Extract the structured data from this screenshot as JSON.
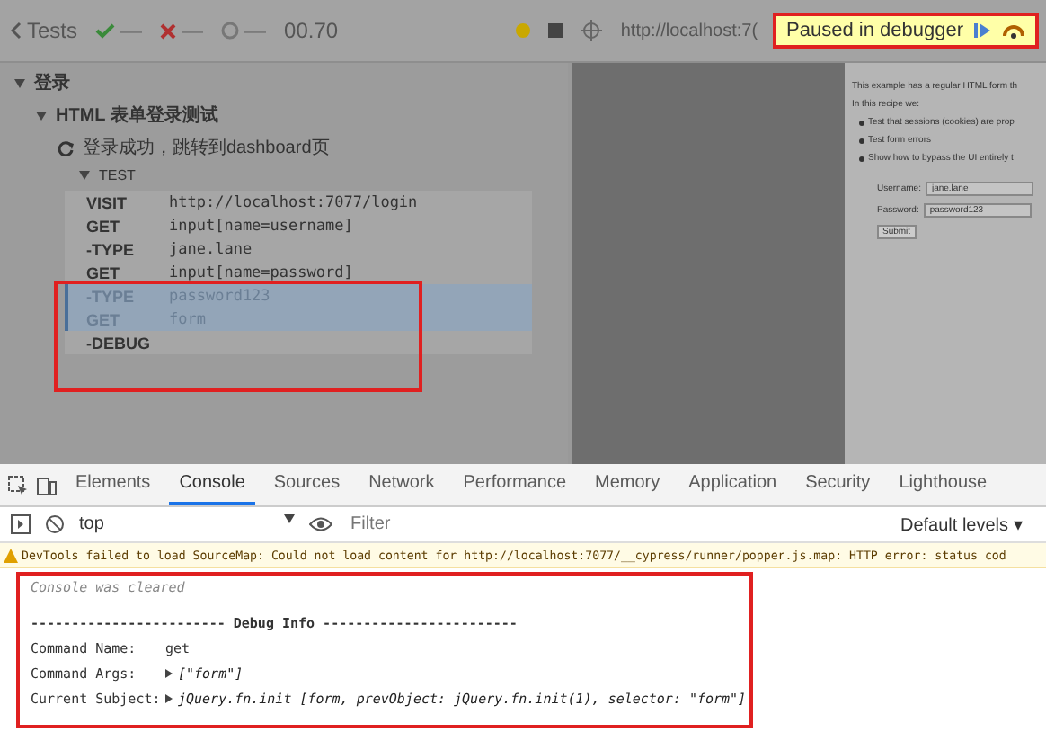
{
  "runner": {
    "back": "Tests",
    "passed": "—",
    "failed": "—",
    "pending": "—",
    "duration": "00.70",
    "url": "http://localhost:7(",
    "paused_banner": "Paused in debugger"
  },
  "command_log": {
    "suite": "登录",
    "spec": "HTML 表单登录测试",
    "test": "登录成功，跳转到dashboard页",
    "section": "TEST",
    "rows": [
      {
        "name": "VISIT",
        "value": "http://localhost:7077/login",
        "selected": false
      },
      {
        "name": "GET",
        "value": "input[name=username]",
        "selected": false
      },
      {
        "name": "-TYPE",
        "value": "jane.lane",
        "selected": false
      },
      {
        "name": "GET",
        "value": "input[name=password]",
        "selected": false
      },
      {
        "name": "-TYPE",
        "value": "password123",
        "selected": true
      },
      {
        "name": "GET",
        "value": "form",
        "selected": true
      },
      {
        "name": "-DEBUG",
        "value": "",
        "selected": false
      }
    ]
  },
  "app_preview": {
    "intro": "This example has a regular HTML form th",
    "recipe": "In this recipe we:",
    "bullets": [
      "Test that sessions (cookies) are prop",
      "Test form errors",
      "Show how to bypass the UI entirely t"
    ],
    "username_label": "Username:",
    "username": "jane.lane",
    "password_label": "Password:",
    "password": "password123",
    "submit": "Submit"
  },
  "devtools": {
    "tabs": [
      {
        "label": "Elements",
        "selected": false
      },
      {
        "label": "Console",
        "selected": true
      },
      {
        "label": "Sources",
        "selected": false
      },
      {
        "label": "Network",
        "selected": false
      },
      {
        "label": "Performance",
        "selected": false
      },
      {
        "label": "Memory",
        "selected": false
      },
      {
        "label": "Application",
        "selected": false
      },
      {
        "label": "Security",
        "selected": false
      },
      {
        "label": "Lighthouse",
        "selected": false
      }
    ],
    "context": "top",
    "filter_placeholder": "Filter",
    "levels": "Default levels ▾",
    "warning": {
      "text": "DevTools failed to load SourceMap: Could not load content for ",
      "link": "http://localhost:7077/__cypress/runner/popper.js.map",
      "rest": ": HTTP error: status cod"
    },
    "cleared": "Console was cleared",
    "debug_header": "------------------------ Debug Info ------------------------",
    "entries": [
      {
        "label": "Command Name:",
        "value": "get",
        "kind": "plain"
      },
      {
        "label": "Command Args:",
        "value": "[\"form\"]",
        "kind": "object"
      },
      {
        "label": "Current Subject:",
        "value": "jQuery.fn.init [form, prevObject: jQuery.fn.init(1), selector: \"form\"]",
        "kind": "object"
      }
    ]
  }
}
